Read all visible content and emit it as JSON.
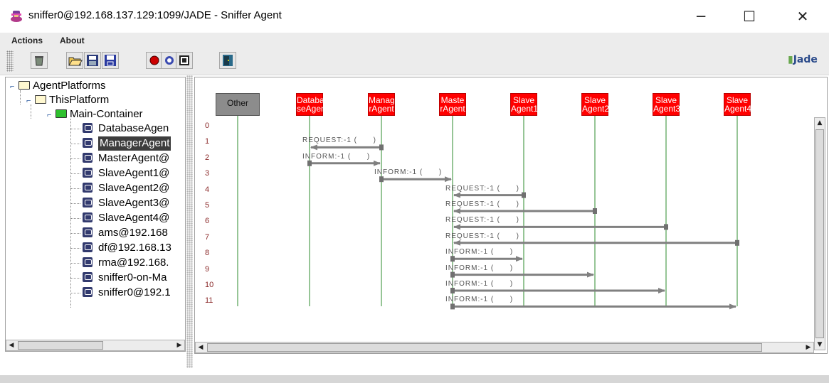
{
  "window": {
    "title": "sniffer0@192.168.137.129:1099/JADE - Sniffer Agent"
  },
  "menu": {
    "items": [
      "Actions",
      "About"
    ]
  },
  "toolbar": {
    "buttons": [
      {
        "icon": "trash-icon"
      },
      {
        "icon": "open-folder-icon"
      },
      {
        "icon": "save-list-icon"
      },
      {
        "icon": "save-icon"
      },
      {
        "icon": "record-icon"
      },
      {
        "icon": "filter-icon"
      },
      {
        "icon": "display-icon"
      },
      {
        "icon": "exit-door-icon"
      }
    ],
    "logo": "Jade"
  },
  "tree": {
    "root": "AgentPlatforms",
    "platform": "ThisPlatform",
    "container": "Main-Container",
    "agents": [
      "DatabaseAgen",
      "ManagerAgent",
      "MasterAgent@",
      "SlaveAgent1@",
      "SlaveAgent2@",
      "SlaveAgent3@",
      "SlaveAgent4@",
      "ams@192.168",
      "df@192.168.13",
      "rma@192.168.",
      "sniffer0-on-Ma",
      "sniffer0@192.1"
    ],
    "selected_index": 1
  },
  "sniffer": {
    "agents": [
      {
        "label": "Other",
        "style": "grey"
      },
      {
        "label": "Databa seAgent",
        "style": "red"
      },
      {
        "label": "Manage rAgent",
        "style": "red"
      },
      {
        "label": "Maste rAgent",
        "style": "red"
      },
      {
        "label": "Slave Agent1",
        "style": "red"
      },
      {
        "label": "Slave Agent2",
        "style": "red"
      },
      {
        "label": "Slave Agent3",
        "style": "red"
      },
      {
        "label": "Slave Agent4",
        "style": "red"
      }
    ],
    "rows": [
      "0",
      "1",
      "2",
      "3",
      "4",
      "5",
      "6",
      "7",
      "8",
      "9",
      "10",
      "11"
    ],
    "messages": [
      {
        "row": 1,
        "from": 2,
        "to": 1,
        "label": "REQUEST:-1 (      )"
      },
      {
        "row": 2,
        "from": 1,
        "to": 2,
        "label": "INFORM:-1 (      )"
      },
      {
        "row": 3,
        "from": 2,
        "to": 3,
        "label": "INFORM:-1 (      )"
      },
      {
        "row": 4,
        "from": 4,
        "to": 3,
        "label": "REQUEST:-1 (      )"
      },
      {
        "row": 5,
        "from": 5,
        "to": 3,
        "label": "REQUEST:-1 (      )"
      },
      {
        "row": 6,
        "from": 6,
        "to": 3,
        "label": "REQUEST:-1 (      )"
      },
      {
        "row": 7,
        "from": 7,
        "to": 3,
        "label": "REQUEST:-1 (      )"
      },
      {
        "row": 8,
        "from": 3,
        "to": 4,
        "label": "INFORM:-1 (      )"
      },
      {
        "row": 9,
        "from": 3,
        "to": 5,
        "label": "INFORM:-1 (      )"
      },
      {
        "row": 10,
        "from": 3,
        "to": 6,
        "label": "INFORM:-1 (      )"
      },
      {
        "row": 11,
        "from": 3,
        "to": 7,
        "label": "INFORM:-1 (      )"
      }
    ]
  },
  "colors": {
    "agent_box": "#ff0000",
    "lifeline": "#2e8b2e",
    "arrow": "#808080",
    "row_number": "#8b2a2a"
  }
}
